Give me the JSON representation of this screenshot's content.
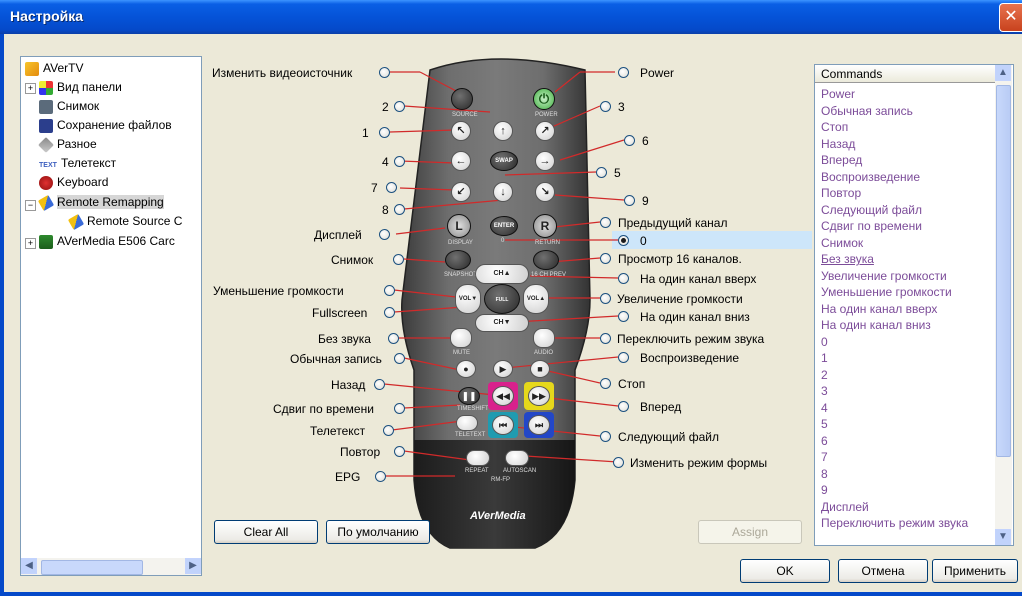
{
  "window": {
    "title": "Настройка",
    "close": "✕"
  },
  "tree": {
    "items": [
      {
        "label": "AVerTV"
      },
      {
        "label": "Вид панели"
      },
      {
        "label": "Снимок"
      },
      {
        "label": "Сохранение файлов"
      },
      {
        "label": "Разное"
      },
      {
        "label": "Телетекст",
        "icon_text": "TEXT"
      },
      {
        "label": "Keyboard"
      },
      {
        "label": "Remote Remapping"
      },
      {
        "label": "Remote Source C"
      },
      {
        "label": "AVerMedia E506 Carc"
      }
    ]
  },
  "left_labels": {
    "change_source": "Изменить видеоисточник",
    "n2": "2",
    "n1": "1",
    "n4": "4",
    "n7": "7",
    "n8": "8",
    "display": "Дисплей",
    "snapshot": "Снимок",
    "vol_down": "Уменьшение громкости",
    "fullscreen": "Fullscreen",
    "mute": "Без звука",
    "record": "Обычная запись",
    "rewind": "Назад",
    "timeshift": "Сдвиг по времени",
    "teletext": "Телетекст",
    "repeat": "Повтор",
    "epg": "EPG"
  },
  "right_labels": {
    "power": "Power",
    "n3": "3",
    "n6": "6",
    "n5": "5",
    "n9": "9",
    "prev_channel": "Предыдущий канал",
    "n0": "0",
    "preview16": "Просмотр 16 каналов.",
    "ch_up": "На один канал вверх",
    "vol_up": "Увеличение громкости",
    "ch_down": "На один канал вниз",
    "audio_mode": "Переключить режим звука",
    "play": "Воспроизведение",
    "stop": "Стоп",
    "forward": "Вперед",
    "next_file": "Следующий файл",
    "form_mode": "Изменить режим формы"
  },
  "remote": {
    "brand": "AVerMedia",
    "labels": {
      "source": "SOURCE",
      "power": "POWER",
      "swap": "SWAP",
      "enter": "ENTER",
      "display": "DISPLAY",
      "return": "RETURN",
      "snapshot": "SNAPSHOT",
      "preview": "16 CH PREV",
      "ch_up": "CH▲",
      "ch_down": "CH▼",
      "vol_down": "VOL▼",
      "vol_up": "VOL▲",
      "full": "FULL SCREEN",
      "mute": "MUTE",
      "audio": "AUDIO",
      "timeshift": "TIMESHIFT",
      "teletext": "TELETEXT",
      "repeat": "REPEAT",
      "autoscan": "AUTOSCAN",
      "model": "RM-FP",
      "l": "L",
      "r": "R",
      "zero": "0"
    }
  },
  "commands": {
    "header": "Commands",
    "items": [
      "Power",
      "Обычная запись",
      "Стоп",
      "Назад",
      "Вперед",
      "Воспроизведение",
      "Повтор",
      "Следующий файл",
      "Сдвиг по времени",
      "Снимок",
      "Без звука",
      "Увеличение громкости",
      "Уменьшение громкости",
      "На один канал вверх",
      "На один канал вниз",
      "0",
      "1",
      "2",
      "3",
      "4",
      "5",
      "6",
      "7",
      "8",
      "9",
      "Дисплей",
      "Переключить режим звука"
    ]
  },
  "buttons": {
    "clear_all": "Clear All",
    "defaults": "По умолчанию",
    "assign": "Assign",
    "ok": "OK",
    "cancel": "Отмена",
    "apply": "Применить"
  },
  "colors": {
    "title_bar": "#0553d8",
    "command_text": "#7c4c99",
    "selection": "#cde6fa",
    "power_green": "#3fae3f"
  }
}
